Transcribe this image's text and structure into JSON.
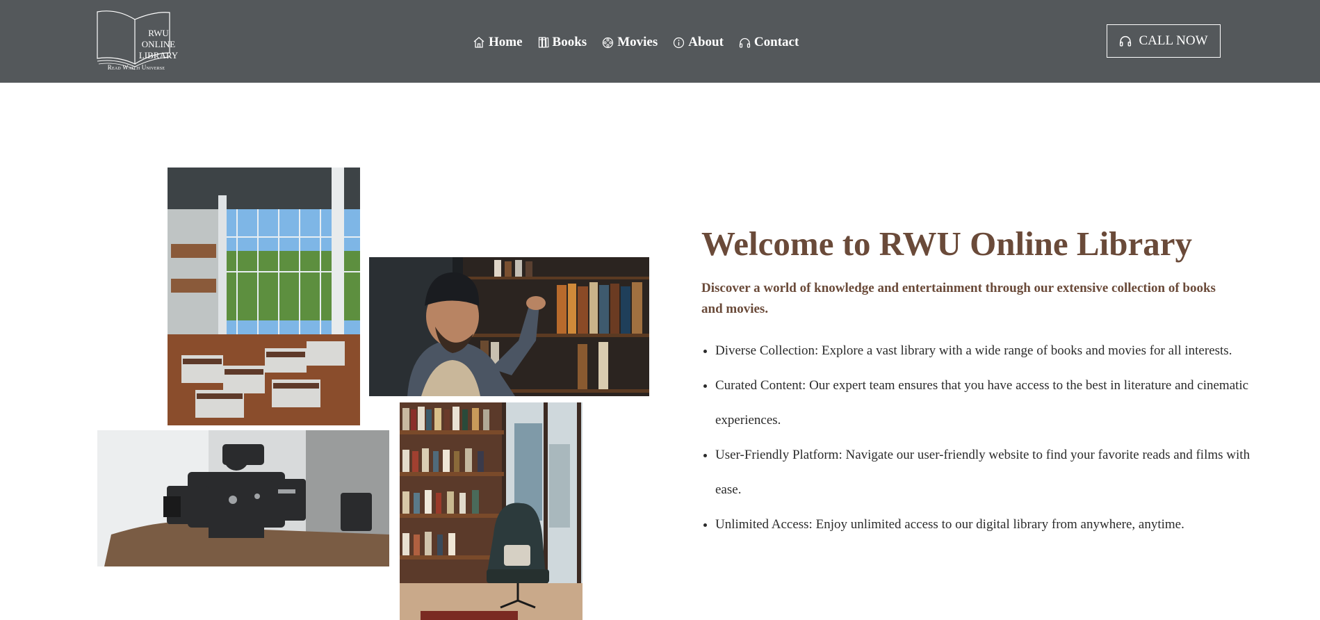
{
  "header": {
    "logo": {
      "lines": [
        "RWU",
        "ONLINE",
        "LIBRARY"
      ],
      "tagline": "Read Watch Universe"
    },
    "nav": [
      {
        "label": "Home",
        "icon": "home-icon"
      },
      {
        "label": "Books",
        "icon": "books-icon"
      },
      {
        "label": "Movies",
        "icon": "film-reel-icon"
      },
      {
        "label": "About",
        "icon": "info-icon"
      },
      {
        "label": "Contact",
        "icon": "headphones-icon"
      }
    ],
    "call_button": {
      "label": "CALL NOW",
      "icon": "headphones-icon"
    }
  },
  "colors": {
    "header_bg": "#54585b",
    "accent_brown": "#6a4a39",
    "body_text": "#2b2b2b"
  },
  "hero": {
    "title": "Welcome to RWU Online Library",
    "subtitle": "Discover a world of knowledge and entertainment through our extensive collection of books and movies.",
    "features": [
      "Diverse Collection: Explore a vast library with a wide range of books and movies for all interests.",
      "Curated Content: Our expert team ensures that you have access to the best in literature and cinematic experiences.",
      "User-Friendly Platform: Navigate our user-friendly website to find your favorite reads and films with ease.",
      "Unlimited Access: Enjoy unlimited access to our digital library from anywhere, anytime."
    ]
  },
  "gallery": [
    {
      "name": "library-interior-photo"
    },
    {
      "name": "man-browsing-bookshelf-photo"
    },
    {
      "name": "cinema-camera-photo"
    },
    {
      "name": "bookshelf-armchair-photo"
    }
  ]
}
